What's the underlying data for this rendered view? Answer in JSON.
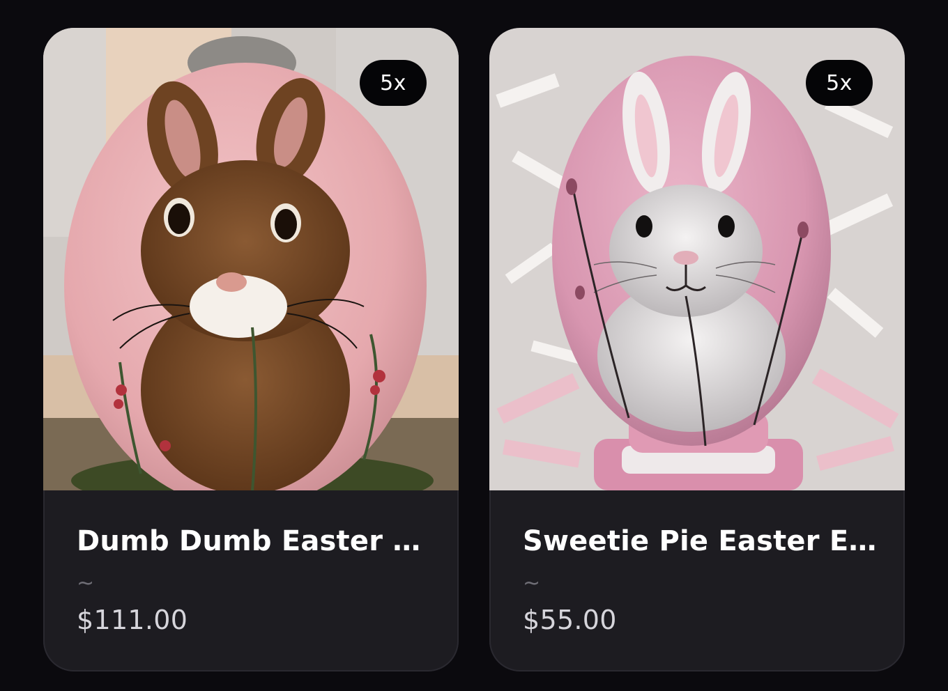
{
  "products": [
    {
      "title": "Dumb Dumb Easter E...",
      "subtitle": "~",
      "price": "$111.00",
      "badge": "5x",
      "image_icon": "brown-bunny-egg-image"
    },
    {
      "title": "Sweetie Pie Easter Egg",
      "subtitle": "~",
      "price": "$55.00",
      "badge": "5x",
      "image_icon": "white-bunny-egg-image"
    }
  ],
  "colors": {
    "background": "#0b0a0e",
    "card": "#1d1c21",
    "badge": "#050507",
    "title": "#ffffff",
    "price": "#d6d5db"
  }
}
